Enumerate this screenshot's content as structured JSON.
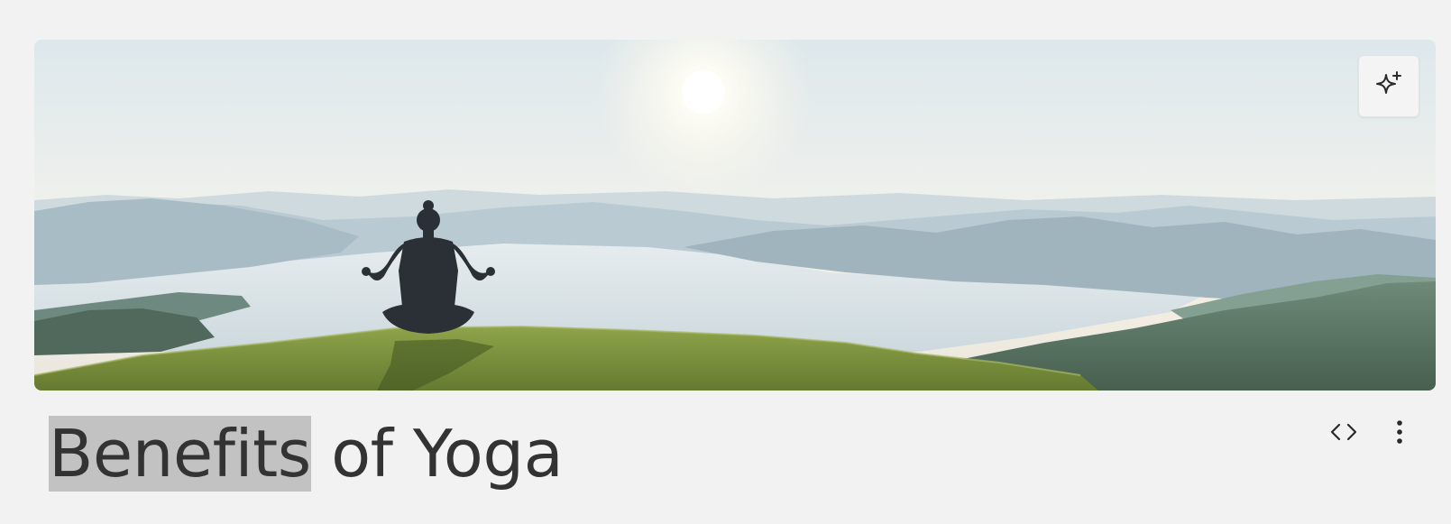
{
  "page": {
    "title_selected": "Benefits",
    "title_rest": " of Yoga"
  },
  "hero": {
    "alt": "Person meditating on a grassy hilltop overlooking a misty lake and mountains"
  },
  "icons": {
    "ai_button": "sparkle-icon",
    "code_button": "code-icon",
    "more_button": "more-vertical-icon"
  },
  "colors": {
    "background": "#f2f2f2",
    "title_text": "#333333",
    "selection_highlight": "#c2c2c2"
  }
}
